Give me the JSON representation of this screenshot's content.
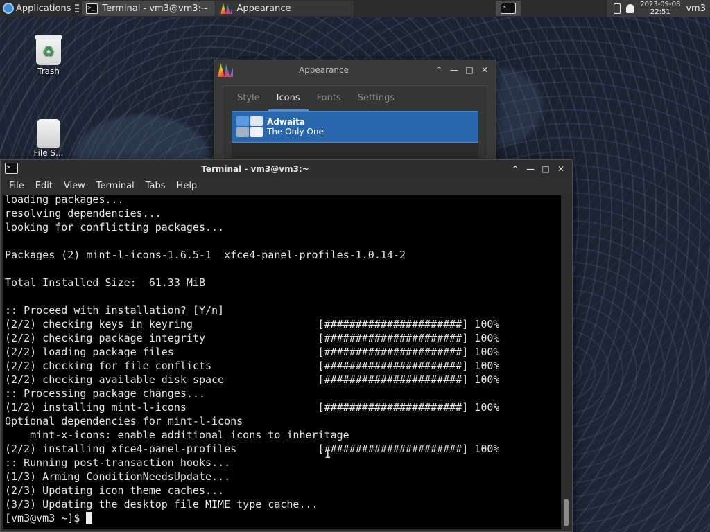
{
  "panel": {
    "applications_label": "Applications",
    "tasks": [
      {
        "label": "Terminal - vm3@vm3:~",
        "icon": "terminal-icon"
      },
      {
        "label": "Appearance",
        "icon": "appearance-icon"
      }
    ],
    "clock_date": "2023-09-08",
    "clock_time": "22:51",
    "user": "vm3"
  },
  "desktop": {
    "icons": [
      {
        "label": "Trash",
        "icon": "trash-icon"
      },
      {
        "label": "File S...",
        "icon": "drive-icon"
      }
    ]
  },
  "appearance_window": {
    "title": "Appearance",
    "tabs": [
      "Style",
      "Icons",
      "Fonts",
      "Settings"
    ],
    "selected_tab": "Icons",
    "theme_name": "Adwaita",
    "theme_desc": "The Only One",
    "accent": "#2a66ac"
  },
  "terminal_window": {
    "title": "Terminal - vm3@vm3:~",
    "menu": [
      "File",
      "Edit",
      "View",
      "Terminal",
      "Tabs",
      "Help"
    ],
    "lines": [
      "loading packages...",
      "resolving dependencies...",
      "looking for conflicting packages...",
      "",
      "Packages (2) mint-l-icons-1.6.5-1  xfce4-panel-profiles-1.0.14-2",
      "",
      "Total Installed Size:  61.33 MiB",
      "",
      ":: Proceed with installation? [Y/n]",
      "(2/2) checking keys in keyring                    [######################] 100%",
      "(2/2) checking package integrity                  [######################] 100%",
      "(2/2) loading package files                       [######################] 100%",
      "(2/2) checking for file conflicts                 [######################] 100%",
      "(2/2) checking available disk space               [######################] 100%",
      ":: Processing package changes...",
      "(1/2) installing mint-l-icons                     [######################] 100%",
      "Optional dependencies for mint-l-icons",
      "    mint-x-icons: enable additional icons to inheritage",
      "(2/2) installing xfce4-panel-profiles             [######################] 100%",
      ":: Running post-transaction hooks...",
      "(1/3) Arming ConditionNeedsUpdate...",
      "(2/3) Updating icon theme caches...",
      "(3/3) Updating the desktop file MIME type cache..."
    ],
    "prompt": "[vm3@vm3 ~]$ "
  }
}
